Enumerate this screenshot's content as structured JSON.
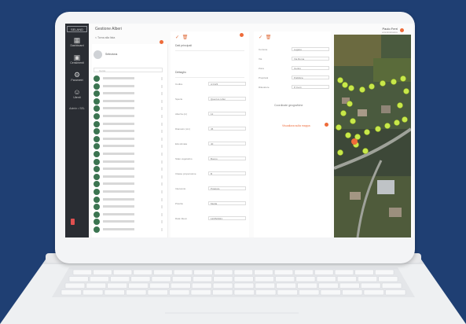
{
  "app": {
    "brand": "SELAND",
    "page_title": "Gestione Alberi",
    "breadcrumb": "< Torna alla lista",
    "profile_name": "Paolo Ferri",
    "profile_sub": "amministratore"
  },
  "sidebar": {
    "items": [
      {
        "label": "Dashboard",
        "icon": "building-icon"
      },
      {
        "label": "Censimenti",
        "icon": "calendar-icon"
      },
      {
        "label": "Parametri",
        "icon": "settings-icon"
      },
      {
        "label": "Utenti",
        "icon": "user-icon"
      }
    ],
    "user_line": "Admin • SEL"
  },
  "list": {
    "header": "Seleziona",
    "search_placeholder": "Cerca",
    "rows": 21
  },
  "form": {
    "toolbar": "✓  🗑",
    "section_main": "Dati principali",
    "section_detail": "Dettaglio",
    "fields": [
      {
        "label": "Codice",
        "value": "A 0123"
      },
      {
        "label": "Specie",
        "value": "Quercus robur"
      },
      {
        "label": "Altezza (m)",
        "value": "12"
      },
      {
        "label": "Diametro (cm)",
        "value": "45"
      },
      {
        "label": "Età stimata",
        "value": "40"
      },
      {
        "label": "Stato vegetativo",
        "value": "Buono"
      },
      {
        "label": "Classe propensione",
        "value": "B"
      },
      {
        "label": "Intervento",
        "value": "Potatura"
      },
      {
        "label": "Priorità",
        "value": "Media"
      },
      {
        "label": "Data rilievo",
        "value": "12/05/2021"
      }
    ]
  },
  "form2": {
    "toolbar": "✓  🗑",
    "fields": [
      {
        "label": "Comune",
        "value": "Lugano"
      },
      {
        "label": "Via",
        "value": "Via Roma"
      },
      {
        "label": "Zona",
        "value": "Centro"
      },
      {
        "label": "Proprietà",
        "value": "Pubblica"
      },
      {
        "label": "Rilevatore",
        "value": "P. Ferri"
      }
    ],
    "mid_text": "Coordinate geografiche",
    "link_text": "Visualizza sulla mappa"
  },
  "colors": {
    "sidebar": "#2a2d33",
    "accent": "#ee6b3a",
    "avatar": "#3b7450",
    "tree_marker": "#c8e84a",
    "background": "#1f3f73"
  }
}
